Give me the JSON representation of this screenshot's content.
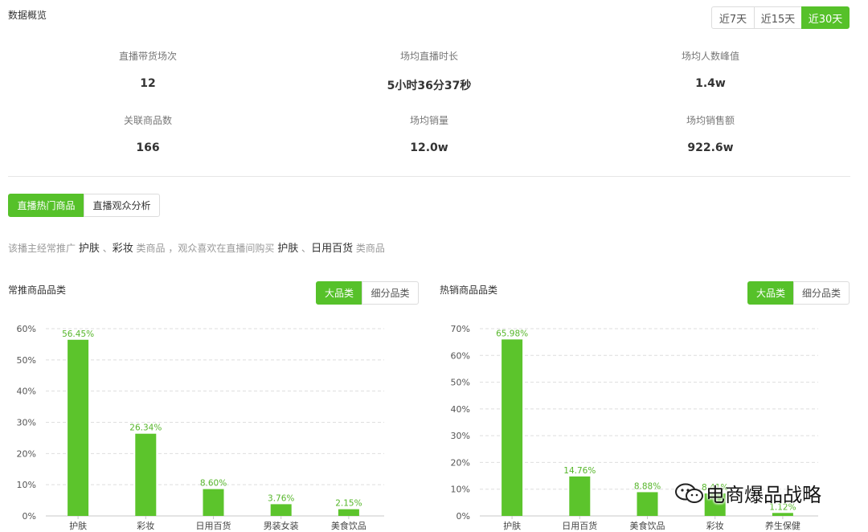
{
  "overview": {
    "title": "数据概览",
    "ranges": [
      {
        "label": "近7天",
        "active": false
      },
      {
        "label": "近15天",
        "active": false
      },
      {
        "label": "近30天",
        "active": true
      }
    ],
    "stats": [
      {
        "label": "直播带货场次",
        "value": "12"
      },
      {
        "label": "场均直播时长",
        "value": "5小时36分37秒"
      },
      {
        "label": "场均人数峰值",
        "value": "1.4w"
      },
      {
        "label": "关联商品数",
        "value": "166"
      },
      {
        "label": "场均销量",
        "value": "12.0w"
      },
      {
        "label": "场均销售额",
        "value": "922.6w"
      }
    ]
  },
  "view_tabs": [
    {
      "label": "直播热门商品",
      "active": true
    },
    {
      "label": "直播观众分析",
      "active": false
    }
  ],
  "summary": {
    "prefix": "该播主经常推广",
    "promo1": "护肤",
    "sep1": "、",
    "promo2": "彩妆",
    "mid": "类商品 ，观众喜欢在直播间购买",
    "buy1": "护肤",
    "sep2": "、",
    "buy2": "日用百货",
    "suffix": "类商品"
  },
  "category_tabs": {
    "major": "大品类",
    "minor": "细分品类"
  },
  "colors": {
    "accent": "#56c12a",
    "bar": "#5cc42c",
    "label": "#56b62a"
  },
  "chart_data": [
    {
      "type": "bar",
      "title": "常推商品品类",
      "categories": [
        "护肤",
        "彩妆",
        "日用百货",
        "男装女装",
        "美食饮品"
      ],
      "values": [
        56.45,
        26.34,
        8.6,
        3.76,
        2.15
      ],
      "data_labels": [
        "56.45%",
        "26.34%",
        "8.60%",
        "3.76%",
        "2.15%"
      ],
      "ylim": [
        0,
        60
      ],
      "yticks": [
        "0%",
        "10%",
        "20%",
        "30%",
        "40%",
        "50%",
        "60%"
      ],
      "grid": true
    },
    {
      "type": "bar",
      "title": "热销商品品类",
      "categories": [
        "护肤",
        "日用百货",
        "美食饮品",
        "彩妆",
        "养生保健"
      ],
      "values": [
        65.98,
        14.76,
        8.88,
        8.41,
        1.12
      ],
      "data_labels": [
        "65.98%",
        "14.76%",
        "8.88%",
        "8.41%",
        "1.12%"
      ],
      "ylim": [
        0,
        70
      ],
      "yticks": [
        "0%",
        "10%",
        "20%",
        "30%",
        "40%",
        "50%",
        "60%",
        "70%"
      ],
      "grid": true
    }
  ],
  "watermark": {
    "icon": "wechat-icon",
    "text": "电商爆品战略"
  }
}
